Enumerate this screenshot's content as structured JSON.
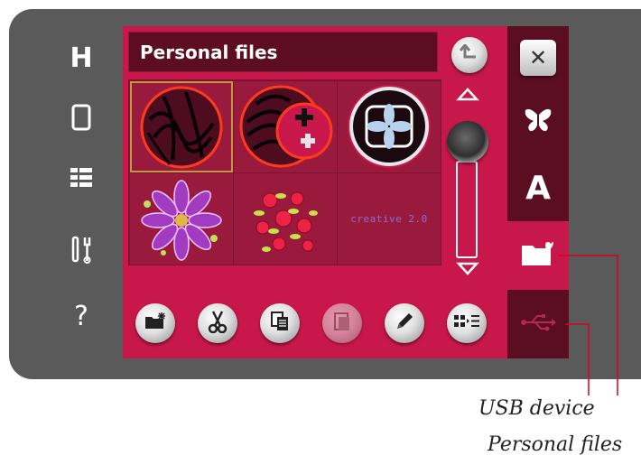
{
  "header": {
    "title": "Personal files"
  },
  "files": [
    {
      "name": "zebra-circle-design"
    },
    {
      "name": "zebra-plus-design"
    },
    {
      "name": "flower-frame-design"
    },
    {
      "name": "starburst-flower-design"
    },
    {
      "name": "rose-bouquet-design"
    },
    {
      "name": "text-design",
      "text": "creative 2.0"
    }
  ],
  "left_bar": {
    "items": [
      {
        "glyph": "H",
        "icon": "home-icon"
      },
      {
        "glyph": "▯",
        "icon": "phone-icon"
      },
      {
        "glyph": "☷",
        "icon": "list-icon"
      },
      {
        "glyph": "⚒",
        "icon": "tools-icon"
      },
      {
        "glyph": "?",
        "icon": "help-icon"
      }
    ]
  },
  "tabs": {
    "close_glyph": "✕",
    "font_glyph": "A"
  },
  "annotations": {
    "usb_label": "USB device",
    "personal_label": "Personal files"
  },
  "colors": {
    "screen": "#c8184b",
    "frame": "#5a5a5a",
    "callout_line": "#d6001c"
  }
}
